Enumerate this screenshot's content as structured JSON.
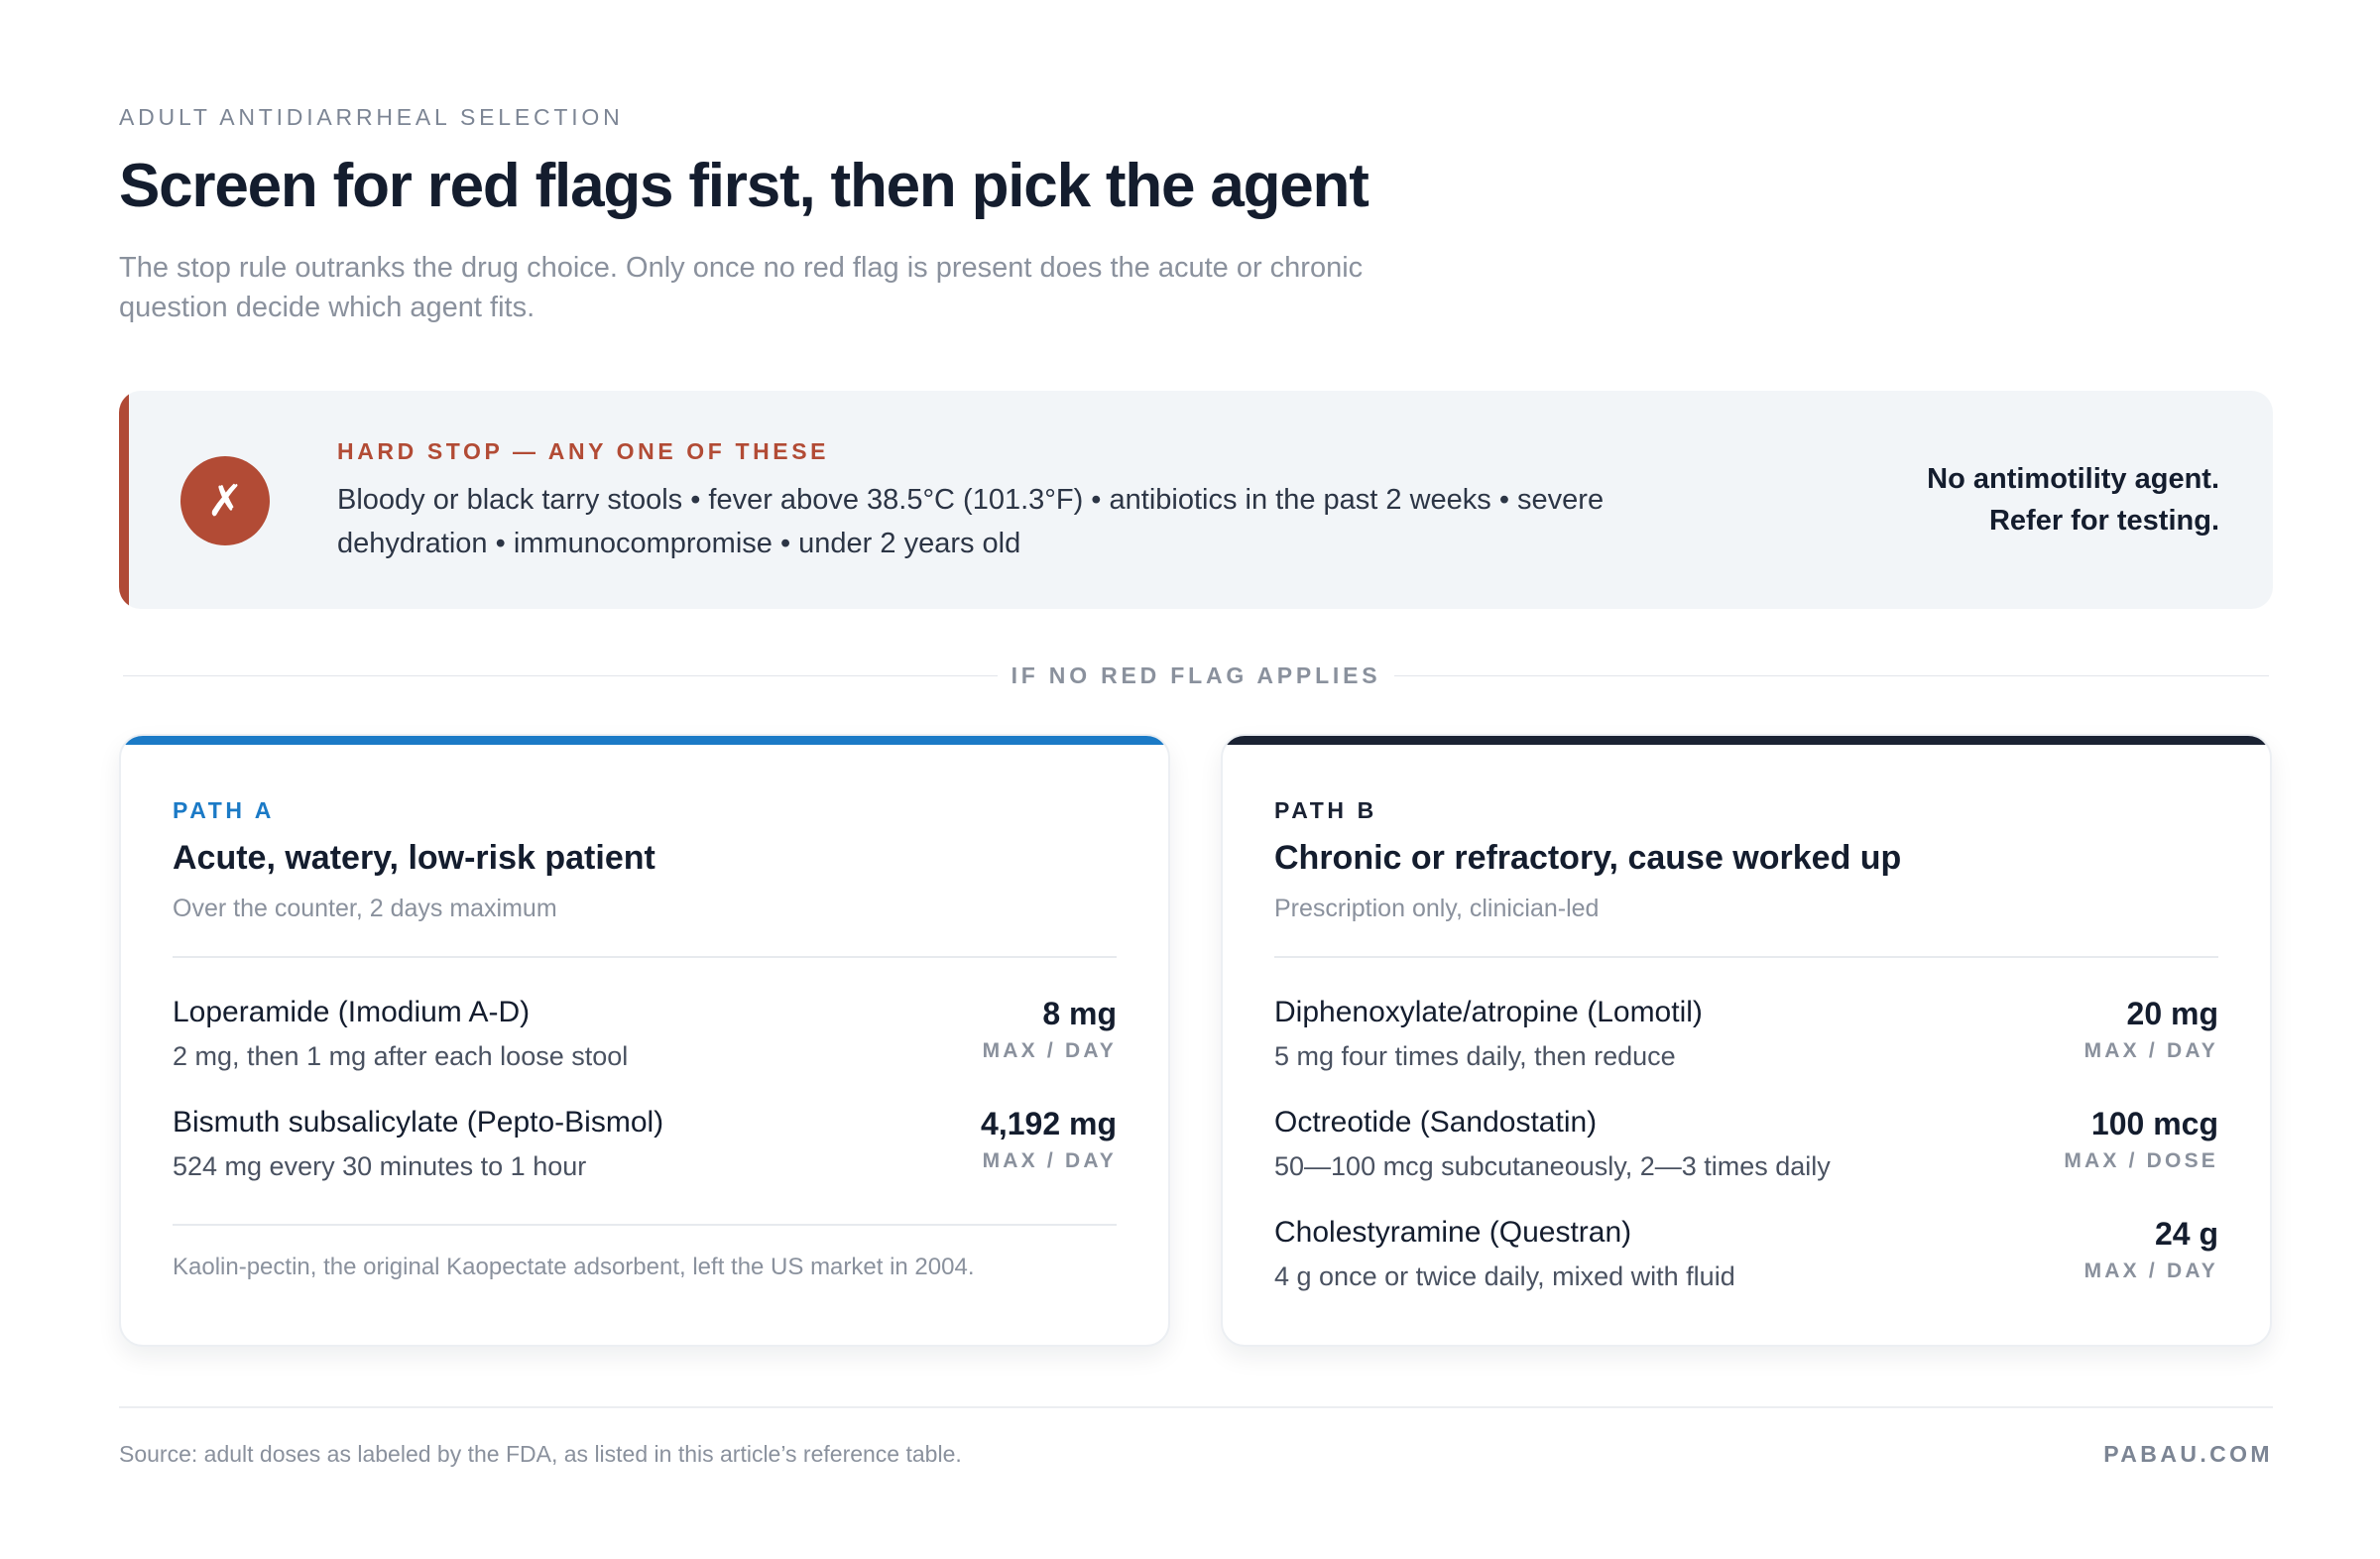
{
  "header": {
    "eyebrow": "ADULT ANTIDIARRHEAL SELECTION",
    "title": "Screen for red flags first, then pick the agent",
    "subtitle": "The stop rule outranks the drug choice. Only once no red flag is present does the acute or chronic question decide which agent fits."
  },
  "hard_stop": {
    "icon": "cross-mark-icon",
    "icon_glyph": "✗",
    "label": "HARD STOP — ANY ONE OF THESE",
    "body": "Bloody or black tarry stools • fever above 38.5°C (101.3°F) • antibiotics in the past 2 weeks • severe dehydration • immunocompromise • under 2 years old",
    "action_line1": "No antimotility agent.",
    "action_line2": "Refer for testing.",
    "accent_color": "#b24b35"
  },
  "divider": {
    "label": "IF NO RED FLAG APPLIES"
  },
  "path_a": {
    "label": "PATH A",
    "title": "Acute, watery, low-risk patient",
    "subtitle": "Over the counter, 2 days maximum",
    "accent_color": "#1b7ac6",
    "drugs": [
      {
        "name": "Loperamide (Imodium A-D)",
        "dose": "2 mg, then 1 mg after each loose stool",
        "max": "8 mg",
        "unit": "MAX / DAY"
      },
      {
        "name": "Bismuth subsalicylate (Pepto-Bismol)",
        "dose": "524 mg every 30 minutes to 1 hour",
        "max": "4,192 mg",
        "unit": "MAX / DAY"
      }
    ],
    "footnote": "Kaolin-pectin, the original Kaopectate adsorbent, left the US market in 2004."
  },
  "path_b": {
    "label": "PATH B",
    "title": "Chronic or refractory, cause worked up",
    "subtitle": "Prescription only, clinician-led",
    "accent_color": "#1a2233",
    "drugs": [
      {
        "name": "Diphenoxylate/atropine (Lomotil)",
        "dose": "5 mg four times daily, then reduce",
        "max": "20 mg",
        "unit": "MAX / DAY"
      },
      {
        "name": "Octreotide (Sandostatin)",
        "dose": "50—100 mcg subcutaneously, 2—3 times daily",
        "max": "100 mcg",
        "unit": "MAX / DOSE"
      },
      {
        "name": "Cholestyramine (Questran)",
        "dose": "4 g once or twice daily, mixed with fluid",
        "max": "24 g",
        "unit": "MAX / DAY"
      }
    ]
  },
  "footer": {
    "source": "Source: adult doses as labeled by the FDA, as listed in this article’s reference table.",
    "brand": "PABAU.COM"
  }
}
